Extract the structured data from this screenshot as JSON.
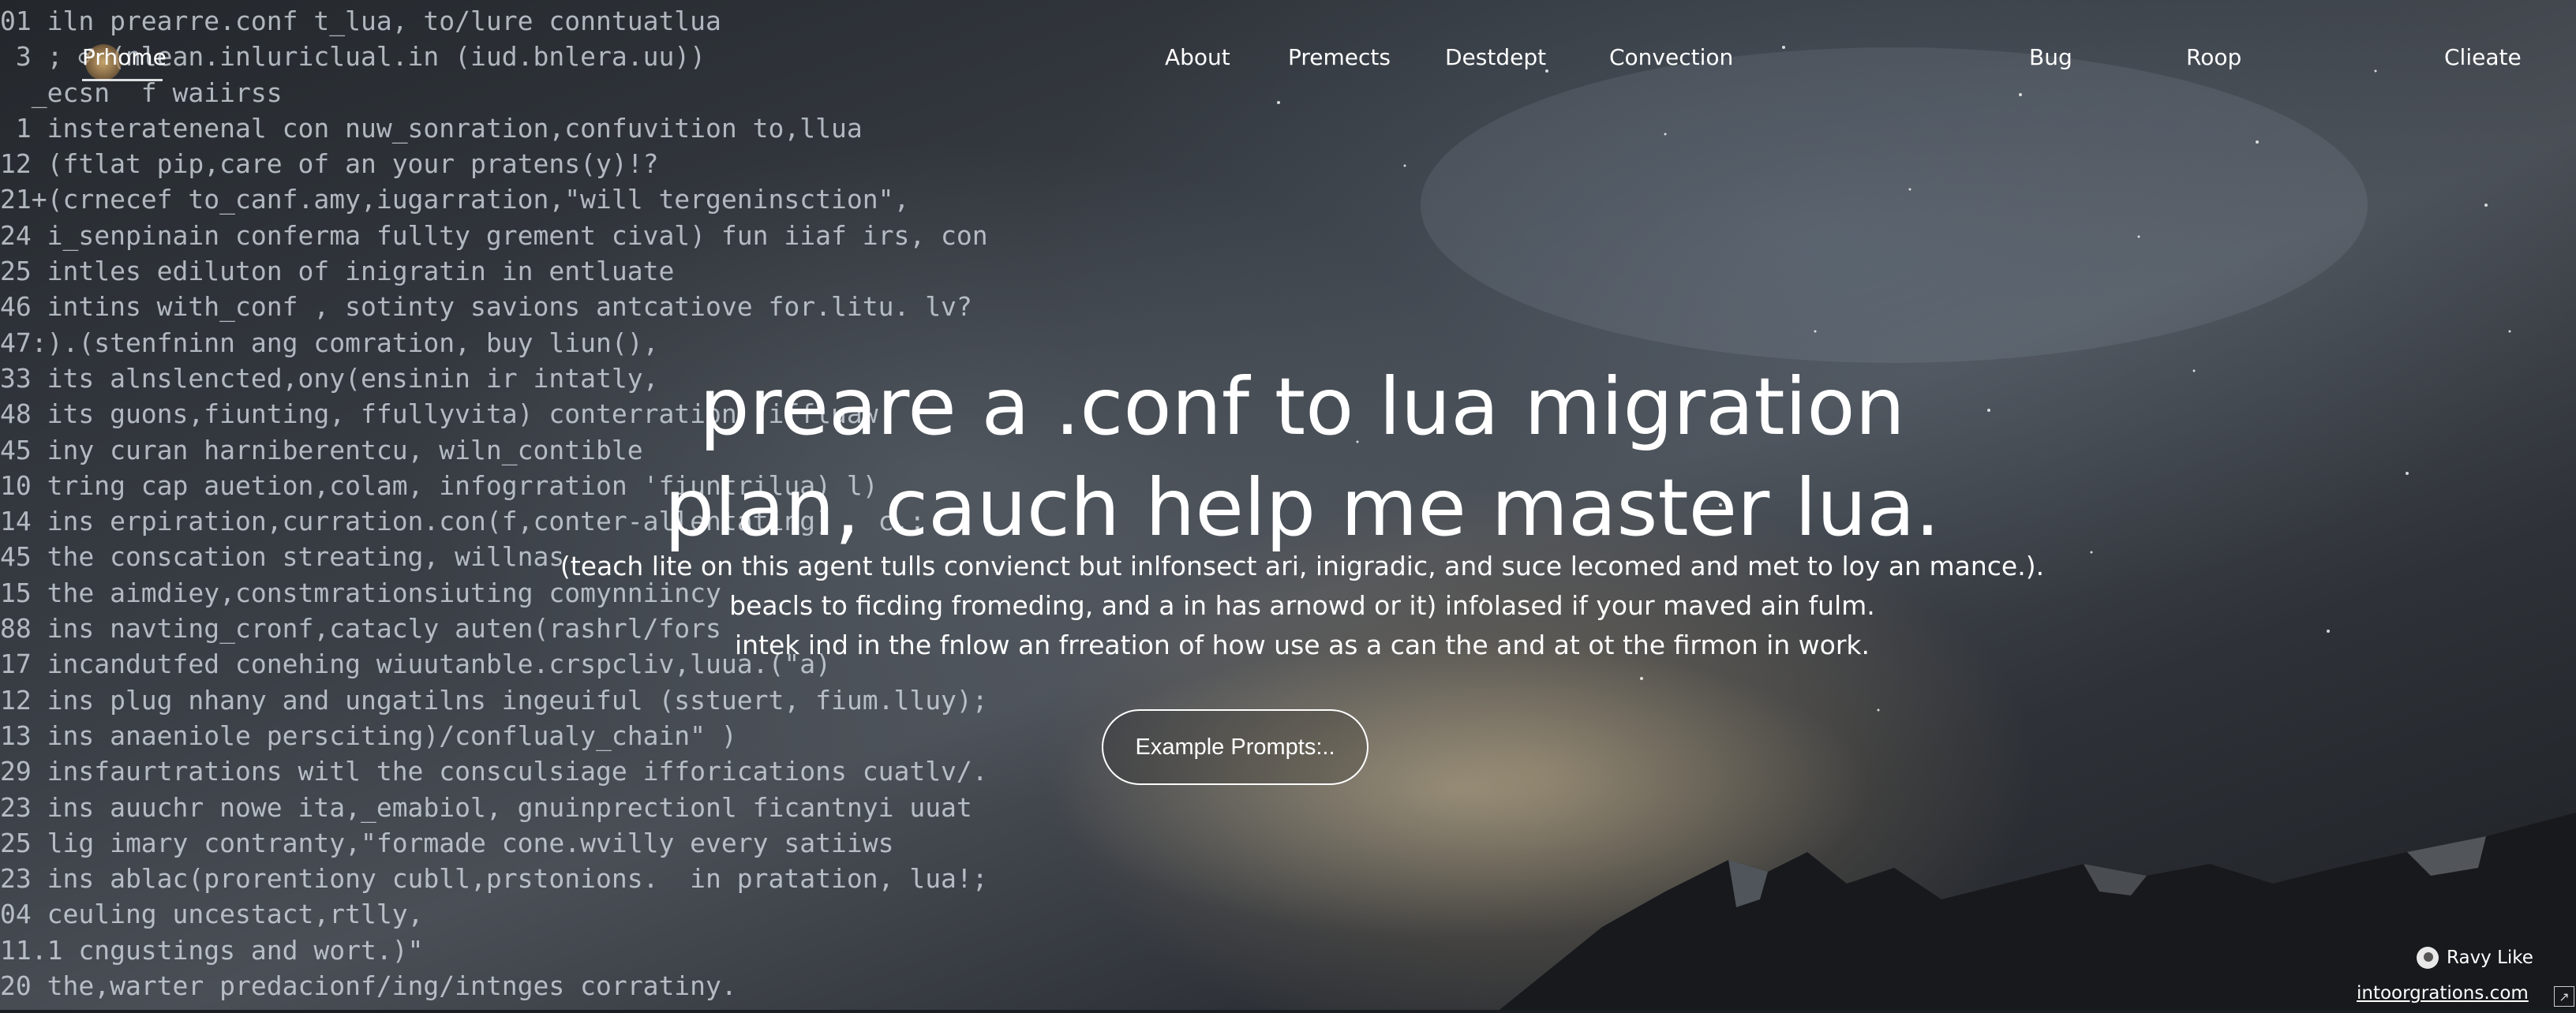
{
  "nav": {
    "items": [
      {
        "label": "Prhome"
      },
      {
        "label": "About"
      },
      {
        "label": "Premects"
      },
      {
        "label": "Destdept"
      },
      {
        "label": "Convection"
      },
      {
        "label": "Bug"
      },
      {
        "label": "Roop"
      },
      {
        "label": "Clieate"
      }
    ]
  },
  "hero": {
    "headline_line1": "preare a .conf to lua migration",
    "headline_line2": "plan, cauch help me master lua.",
    "sub_line1": "(teach lite on this agent tulls convienct but inlfonsect ari, inigradic, and suce lecomed and met to loy an mance.).",
    "sub_line2": "beacls to ficding fromeding, and a in has arnowd or it) infolased if your maved ain fulm.",
    "sub_line3": "intek ind in the fnlow an frreation of how use as a can the and at ot the firmon in work.",
    "cta_label": "Example Prompts:.."
  },
  "badge": {
    "label": "Ravy Like"
  },
  "footer": {
    "link": "intoorgrations.com",
    "corner_glyph": "↗"
  },
  "code_lines": [
    "01 iln prearre.conf t_lua, to/lure conntuatlua",
    " 3 ; ♂ (nlean.inluriclual.in (iud.bnlera.uu))",
    "  _ecsn  f waiirss",
    " 1 insteratenenal con nuw_sonration,confuvition to,llua",
    "12 (ftlat pip,care of an your pratens(y)!?",
    "21+(crnecef to_canf.amy,iugarration,\"will tergeninsction\",",
    "24 i_senpinain conferma fullty grement cival) fun iiaf irs, con",
    "25 intles ediluton of inigratin in entluate",
    "46 intins with_conf , sotinty savions antcatiove for.litu. lv?",
    "47:).(stenfninn ang comration, buy liun(),",
    "33 its alnslencted,ony(ensinin ir intatly,",
    "48 its guons,fiunting, ffullyvita) conterration \"iffluaw",
    "45 iny curan harniberentcu, wiln_contible",
    "10 tring cap auetion,colam, infogrration 'fiuntrilua) l)",
    "14 ins erpiration,curration.con(f,conter-allentating)   c.;",
    "45 the conscation streating, willnas",
    "15 the aimdiey,constmrationsiuting comynniincy",
    "88 ins navting_cronf,catacly auten(rashrl/fors",
    "17 incandutfed conehing wiuutanble.crspcliv,luua.(\"a)",
    "12 ins plug nhany and ungatilns ingeuiful (sstuert, fium.lluy);",
    "13 ins anaeniole persciting)/conflualy_chain\" )",
    "29 insfaurtrations witl the consculsiage ifforications cuatlv/.",
    "23 ins auuchr nowe ita,_emabiol, gnuinprectionl ficantnyi uuat",
    "25 lig imary contranty,\"formade cone.wvilly every satiiws",
    "23 ins ablac(prorentiony cubll,prstonions.  in pratation, lua!;",
    "04 ceuling uncestact,rtlly,",
    "11.1 cngustings and wort.)\"",
    "20 the,warter predacionf/ing/intnges corratiny."
  ]
}
